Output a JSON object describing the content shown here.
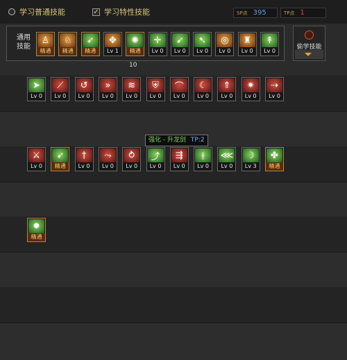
{
  "tabs": {
    "normal": "学习普通技能",
    "special": "学习特性技能"
  },
  "points": {
    "sp_label": "SP点",
    "sp_value": "395",
    "tp_label": "TP点",
    "tp_value": "1"
  },
  "general": {
    "label_line1": "通用",
    "label_line2": "技能"
  },
  "steal_button": "偷学技能",
  "count_label": "10",
  "tooltip": {
    "name": "强化 - 升龙剑",
    "tp": "TP:2"
  },
  "general_skills": [
    {
      "icon": "sit-icon",
      "glyph": "♙",
      "style": "orange",
      "label": "精通"
    },
    {
      "icon": "crouch-icon",
      "glyph": "♘",
      "style": "orange",
      "label": "精通"
    },
    {
      "icon": "sprint-icon",
      "glyph": "➶",
      "style": "green",
      "label": "精通"
    },
    {
      "icon": "wings-icon",
      "glyph": "✥",
      "style": "orange",
      "label": "Lv 1"
    },
    {
      "icon": "target-icon",
      "glyph": "✺",
      "style": "green",
      "label": "精通"
    },
    {
      "icon": "crosshair-icon",
      "glyph": "✛",
      "style": "green",
      "label": "Lv 0"
    },
    {
      "icon": "leap-icon",
      "glyph": "➹",
      "style": "green",
      "label": "Lv 0"
    },
    {
      "icon": "tumble-icon",
      "glyph": "➷",
      "style": "green",
      "label": "Lv 0"
    },
    {
      "icon": "orb-icon",
      "glyph": "◎",
      "style": "orange",
      "label": "Lv 0"
    },
    {
      "icon": "strength-icon",
      "glyph": "♜",
      "style": "orange",
      "label": "Lv 0"
    },
    {
      "icon": "climb-icon",
      "glyph": "↟",
      "style": "green",
      "label": "Lv 0"
    }
  ],
  "row1_skills": [
    {
      "icon": "dash-icon",
      "glyph": "➤",
      "style": "green",
      "label": "Lv 0"
    },
    {
      "icon": "slash-icon",
      "glyph": "⟋",
      "style": "red",
      "label": "Lv 0"
    },
    {
      "icon": "spin-slash-icon",
      "glyph": "↺",
      "style": "red",
      "label": "Lv 0"
    },
    {
      "icon": "multi-strike-icon",
      "glyph": "»",
      "style": "red",
      "label": "Lv 0"
    },
    {
      "icon": "sword-wave-icon",
      "glyph": "≋",
      "style": "red",
      "label": "Lv 0"
    },
    {
      "icon": "shield-icon",
      "glyph": "⛨",
      "style": "red",
      "label": "Lv 0"
    },
    {
      "icon": "arc-slash-icon",
      "glyph": "⌒",
      "style": "red",
      "label": "Lv 0"
    },
    {
      "icon": "crescent-icon",
      "glyph": "☾",
      "style": "red",
      "label": "Lv 0"
    },
    {
      "icon": "rising-icon",
      "glyph": "⇑",
      "style": "red",
      "label": "Lv 0"
    },
    {
      "icon": "burst-icon",
      "glyph": "✷",
      "style": "red",
      "label": "Lv 0"
    },
    {
      "icon": "swift-icon",
      "glyph": "⇢",
      "style": "red",
      "label": "Lv 0"
    }
  ],
  "row2_skills": [
    {
      "icon": "claw-icon",
      "glyph": "⚔",
      "style": "red",
      "label": "Lv 0"
    },
    {
      "icon": "rising-dragon-icon",
      "glyph": "➶",
      "style": "green",
      "label": "精通"
    },
    {
      "icon": "dagger-icon",
      "glyph": "†",
      "style": "red",
      "label": "Lv 0"
    },
    {
      "icon": "blade-arc-icon",
      "glyph": "⤳",
      "style": "red",
      "label": "Lv 0"
    },
    {
      "icon": "cyclone-icon",
      "glyph": "⥁",
      "style": "red",
      "label": "Lv 0"
    },
    {
      "icon": "flying-sword-icon",
      "glyph": "⤴",
      "style": "green",
      "label": "Lv 0"
    },
    {
      "icon": "sword-rain-icon",
      "glyph": "⇶",
      "style": "red",
      "label": "Lv 0"
    },
    {
      "icon": "sword-pillar-icon",
      "glyph": "⫲",
      "style": "green",
      "label": "Lv 0"
    },
    {
      "icon": "wind-cut-icon",
      "glyph": "⋘",
      "style": "green",
      "label": "Lv 0"
    },
    {
      "icon": "moon-slash-icon",
      "glyph": "☽",
      "style": "green",
      "label": "Lv 3"
    },
    {
      "icon": "spirit-icon",
      "glyph": "✤",
      "style": "green",
      "label": "精通"
    }
  ],
  "row4_skills": [
    {
      "icon": "awaken-icon",
      "glyph": "✹",
      "style": "green",
      "label": "精通"
    }
  ]
}
